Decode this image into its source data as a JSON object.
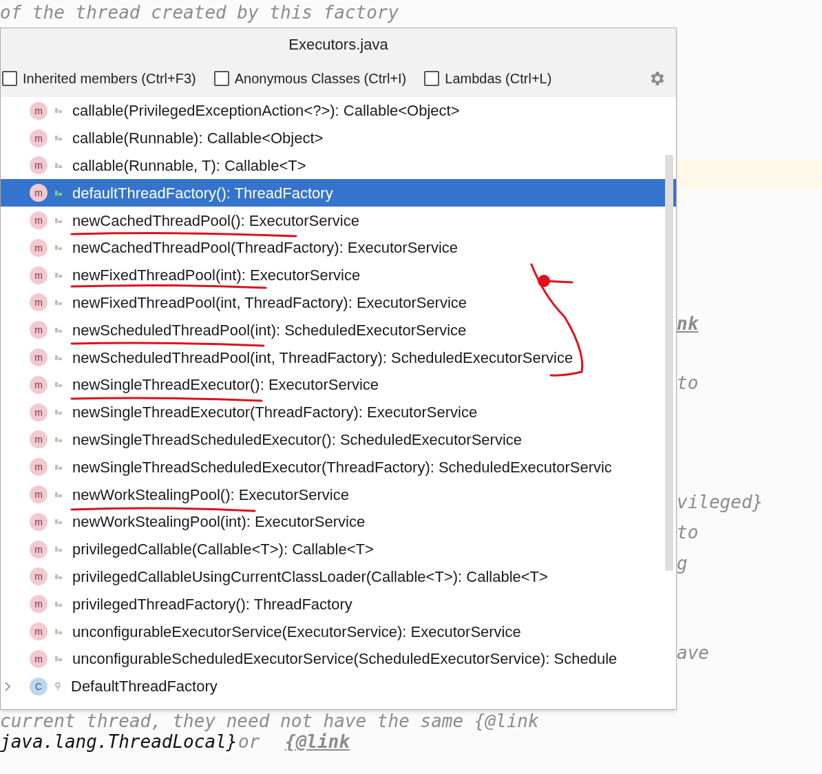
{
  "editor_text": [
    {
      "text": "of the thread created by this factory",
      "kind": "comment"
    },
    {
      "text": "nk",
      "kind": "link"
    },
    {
      "text": "to",
      "kind": "comment"
    },
    {
      "text": "vileged}",
      "kind": "comment"
    },
    {
      "text": "to",
      "kind": "comment"
    },
    {
      "text": "g",
      "kind": "comment"
    },
    {
      "text": "ave",
      "kind": "comment"
    },
    {
      "text": "current thread, they need not have the same {@link",
      "kind": "comment"
    },
    {
      "text": "java.lang.ThreadLocal}",
      "kind": "code"
    },
    {
      "text": "or",
      "kind": "comment"
    },
    {
      "text": "{@link",
      "kind": "link"
    }
  ],
  "popup": {
    "title": "Executors.java",
    "filters": [
      {
        "label": "Inherited members (Ctrl+F3)",
        "checked": false
      },
      {
        "label": "Anonymous Classes (Ctrl+I)",
        "checked": false
      },
      {
        "label": "Lambdas (Ctrl+L)",
        "checked": false
      }
    ],
    "items": [
      {
        "kind": "method",
        "badge": "m",
        "label": "callable(PrivilegedExceptionAction<?>): Callable<Object>",
        "selected": false
      },
      {
        "kind": "method",
        "badge": "m",
        "label": "callable(Runnable): Callable<Object>",
        "selected": false
      },
      {
        "kind": "method",
        "badge": "m",
        "label": "callable(Runnable, T): Callable<T>",
        "selected": false
      },
      {
        "kind": "method",
        "badge": "m",
        "label": "defaultThreadFactory(): ThreadFactory",
        "selected": true
      },
      {
        "kind": "method",
        "badge": "m",
        "label": "newCachedThreadPool(): ExecutorService",
        "selected": false
      },
      {
        "kind": "method",
        "badge": "m",
        "label": "newCachedThreadPool(ThreadFactory): ExecutorService",
        "selected": false
      },
      {
        "kind": "method",
        "badge": "m",
        "label": "newFixedThreadPool(int): ExecutorService",
        "selected": false
      },
      {
        "kind": "method",
        "badge": "m",
        "label": "newFixedThreadPool(int, ThreadFactory): ExecutorService",
        "selected": false
      },
      {
        "kind": "method",
        "badge": "m",
        "label": "newScheduledThreadPool(int): ScheduledExecutorService",
        "selected": false
      },
      {
        "kind": "method",
        "badge": "m",
        "label": "newScheduledThreadPool(int, ThreadFactory): ScheduledExecutorService",
        "selected": false
      },
      {
        "kind": "method",
        "badge": "m",
        "label": "newSingleThreadExecutor(): ExecutorService",
        "selected": false
      },
      {
        "kind": "method",
        "badge": "m",
        "label": "newSingleThreadExecutor(ThreadFactory): ExecutorService",
        "selected": false
      },
      {
        "kind": "method",
        "badge": "m",
        "label": "newSingleThreadScheduledExecutor(): ScheduledExecutorService",
        "selected": false
      },
      {
        "kind": "method",
        "badge": "m",
        "label": "newSingleThreadScheduledExecutor(ThreadFactory): ScheduledExecutorServic",
        "selected": false
      },
      {
        "kind": "method",
        "badge": "m",
        "label": "newWorkStealingPool(): ExecutorService",
        "selected": false
      },
      {
        "kind": "method",
        "badge": "m",
        "label": "newWorkStealingPool(int): ExecutorService",
        "selected": false
      },
      {
        "kind": "method",
        "badge": "m",
        "label": "privilegedCallable(Callable<T>): Callable<T>",
        "selected": false
      },
      {
        "kind": "method",
        "badge": "m",
        "label": "privilegedCallableUsingCurrentClassLoader(Callable<T>): Callable<T>",
        "selected": false
      },
      {
        "kind": "method",
        "badge": "m",
        "label": "privilegedThreadFactory(): ThreadFactory",
        "selected": false
      },
      {
        "kind": "method",
        "badge": "m",
        "label": "unconfigurableExecutorService(ExecutorService): ExecutorService",
        "selected": false
      },
      {
        "kind": "method",
        "badge": "m",
        "label": "unconfigurableScheduledExecutorService(ScheduledExecutorService): Schedule",
        "selected": false
      },
      {
        "kind": "class",
        "badge": "C",
        "label": "DefaultThreadFactory",
        "selected": false,
        "expanded": false
      }
    ]
  }
}
